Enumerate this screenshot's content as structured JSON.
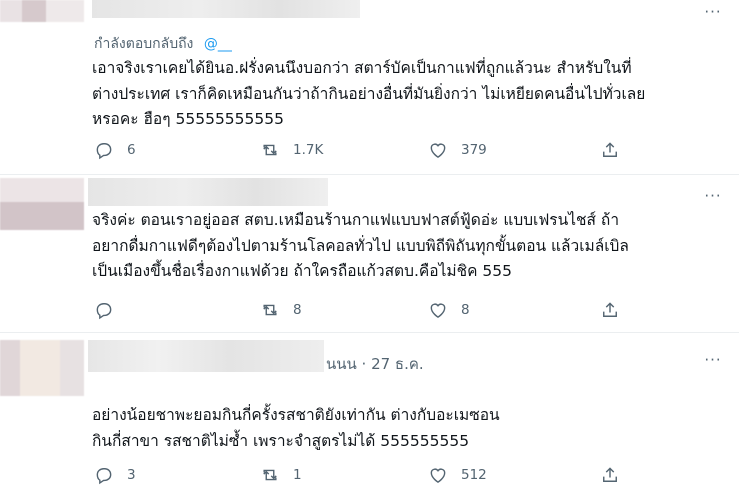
{
  "tweets": [
    {
      "reply_prefix": "กำลังตอบกลับถึง",
      "reply_handle": "@__",
      "lines": [
        "เอาจริงเราเคยได้ยินอ.ฝรั่งคนนึงบอกว่า สตาร์บัคเป็นกาแฟที่ถูกแล้วนะ สำหรับในที่",
        "ต่างประเทศ เราก็คิดเหมือนกันว่าถ้ากินอย่างอื่นที่มันยิ่งกว่า ไม่เหยียดคนอื่นไปทั่วเลย",
        "หรอคะ ฮือๆ 55555555555"
      ],
      "replies": "6",
      "retweets": "1.7K",
      "likes": "379",
      "more": "···"
    },
    {
      "lines": [
        "จริงค่ะ ตอนเราอยู่ออส สตบ.เหมือนร้านกาแฟแบบฟาสต์ฟู้ดอ่ะ แบบเฟรนไชส์ ถ้า",
        "อยากดื่มกาแฟดีๆต้องไปตามร้านโลคอลทั่วไป แบบพิถีพิถันทุกขั้นตอน แล้วเมล์เบิล",
        "เป็นเมืองขึ้นชื่อเรื่องกาแฟด้วย ถ้าใครถือแก้วสตบ.คือไม่ชิค 555"
      ],
      "replies": "",
      "retweets": "8",
      "likes": "8",
      "more": "···"
    },
    {
      "meta": "นนน · 27 ธ.ค.",
      "lines": [
        "อย่างน้อยชาพะยอมกินกี่ครั้งรสชาติยังเท่ากัน ต่างกับอะเมซอน",
        "กินกี่สาขา รสชาติไม่ซ้ำ เพราะจำสูตรไม่ได้ 555555555"
      ],
      "replies": "3",
      "retweets": "1",
      "likes": "512",
      "more": "···"
    }
  ],
  "icons": {
    "reply": "reply-icon",
    "retweet": "retweet-icon",
    "like": "heart-icon",
    "share": "share-icon",
    "more": "more-icon"
  },
  "colors": {
    "text": "#0f1419",
    "muted": "#536471",
    "divider": "#ebeef0"
  }
}
